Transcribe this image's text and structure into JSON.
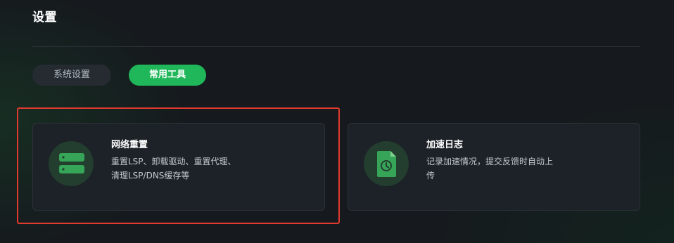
{
  "header": {
    "title": "设置"
  },
  "tabs": [
    {
      "label": "系统设置",
      "active": false
    },
    {
      "label": "常用工具",
      "active": true
    }
  ],
  "cards": [
    {
      "title": "网络重置",
      "desc_line1": "重置LSP、卸载驱动、重置代理、",
      "desc_line2": "清理LSP/DNS缓存等",
      "icon": "server-icon"
    },
    {
      "title": "加速日志",
      "desc_line1": "记录加速情况，提交反馈时自动上",
      "desc_line2": "传",
      "icon": "log-file-icon"
    }
  ],
  "colors": {
    "accent": "#1fb75a",
    "highlight": "#e03a2e",
    "background": "#161a1e",
    "card": "#1d2228"
  }
}
